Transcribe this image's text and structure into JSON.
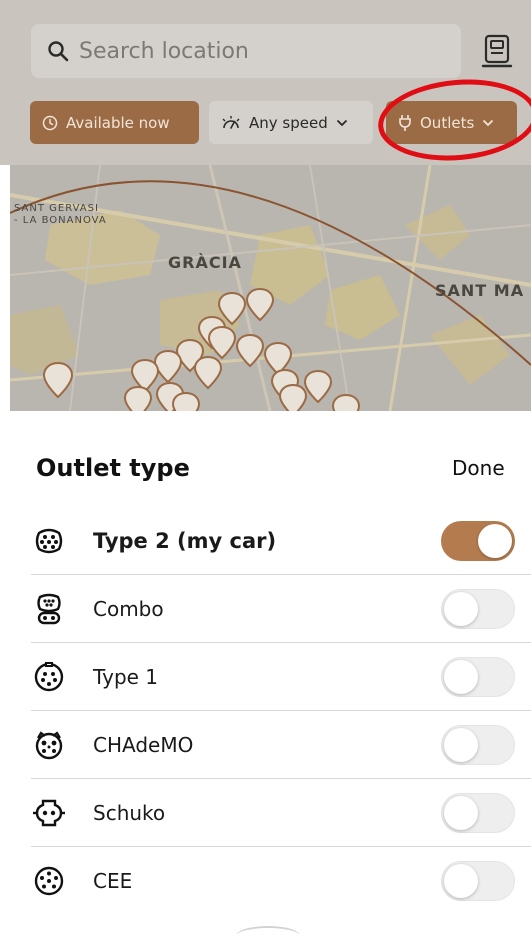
{
  "header": {
    "search": {
      "placeholder": "Search location",
      "icon": "search-icon"
    },
    "scan_button_icon": "charger-scan-icon",
    "chips": {
      "available": {
        "label": "Available now",
        "icon": "clock-icon"
      },
      "speed": {
        "label": "Any speed",
        "icon": "speed-icon",
        "chevron": "chevron-down-icon"
      },
      "outlets": {
        "label": "Outlets",
        "icon": "plug-icon",
        "chevron": "chevron-down-icon"
      }
    },
    "annotation_color": "#e10d14"
  },
  "map": {
    "labels": {
      "sant_gervasi_line1": "SANT GERVASI",
      "sant_gervasi_line2": "- LA BONANOVA",
      "gracia": "GRÀCIA",
      "sant_ma": "SANT MA"
    }
  },
  "sheet": {
    "title": "Outlet type",
    "done_label": "Done",
    "accent_color": "#b47c4e",
    "outlets": [
      {
        "label": "Type 2 (my car)",
        "icon": "type2-connector-icon",
        "enabled": true
      },
      {
        "label": "Combo",
        "icon": "combo-connector-icon",
        "enabled": false
      },
      {
        "label": "Type 1",
        "icon": "type1-connector-icon",
        "enabled": false
      },
      {
        "label": "CHAdeMO",
        "icon": "chademo-connector-icon",
        "enabled": false
      },
      {
        "label": "Schuko",
        "icon": "schuko-connector-icon",
        "enabled": false
      },
      {
        "label": "CEE",
        "icon": "cee-connector-icon",
        "enabled": false
      }
    ]
  }
}
